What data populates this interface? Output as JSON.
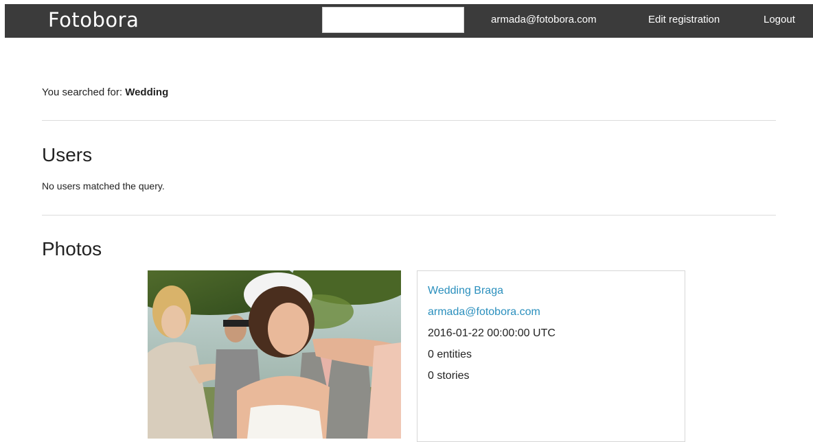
{
  "nav": {
    "brand": "Fotobora",
    "search_value": "",
    "user_email": "armada@fotobora.com",
    "edit_label": "Edit registration",
    "logout_label": "Logout"
  },
  "search": {
    "prefix": "You searched for: ",
    "query": "Wedding"
  },
  "users": {
    "heading": "Users",
    "empty_message": "No users matched the query."
  },
  "photos": {
    "heading": "Photos",
    "items": [
      {
        "title": "Wedding Braga",
        "owner": "armada@fotobora.com",
        "date": "2016-01-22 00:00:00 UTC",
        "entities": "0 entities",
        "stories": "0 stories"
      }
    ]
  },
  "colors": {
    "navbar": "#3b3b3b",
    "link": "#2a8fbd"
  }
}
